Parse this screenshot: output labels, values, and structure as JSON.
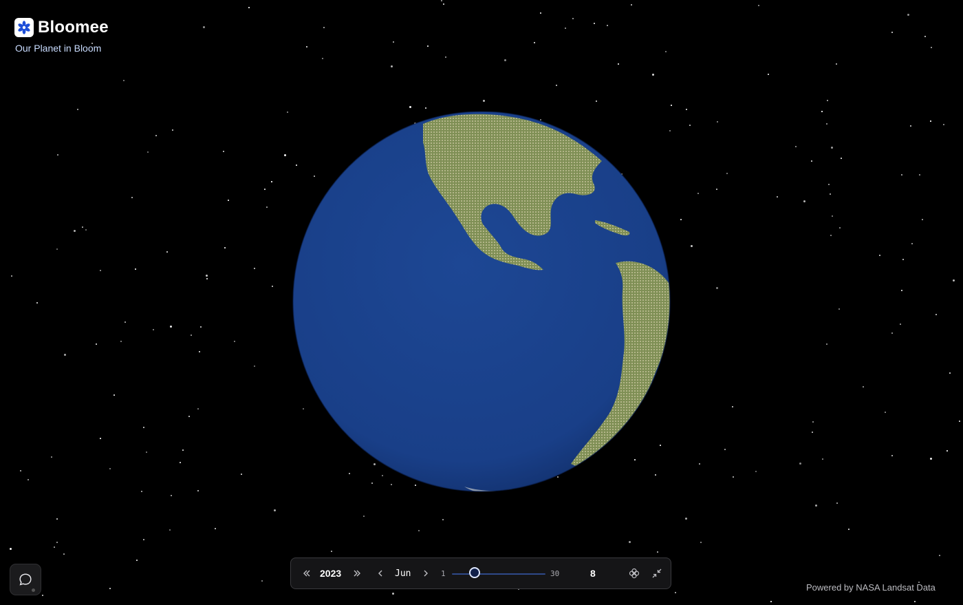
{
  "brand": {
    "name": "Bloomee",
    "tagline": "Our Planet in Bloom",
    "logo_icon": "flower-asterisk-icon",
    "accent": "#1d4ed8"
  },
  "globe": {
    "ocean_color": "#1a3f8a",
    "land_color": "#8a9a5e"
  },
  "controls": {
    "year": "2023",
    "month": "Jun",
    "day_min": "1",
    "day_max": "30",
    "day_value": "8",
    "slider_value": 8,
    "icons": {
      "prev_year": "double-chevron-left-icon",
      "next_year": "double-chevron-right-icon",
      "prev_month": "chevron-left-icon",
      "next_month": "chevron-right-icon",
      "bloom": "flower-icon",
      "minimize": "minimize-icon"
    }
  },
  "chat": {
    "icon": "chat-bubble-icon"
  },
  "footer": {
    "credit": "Powered by NASA Landsat Data"
  }
}
